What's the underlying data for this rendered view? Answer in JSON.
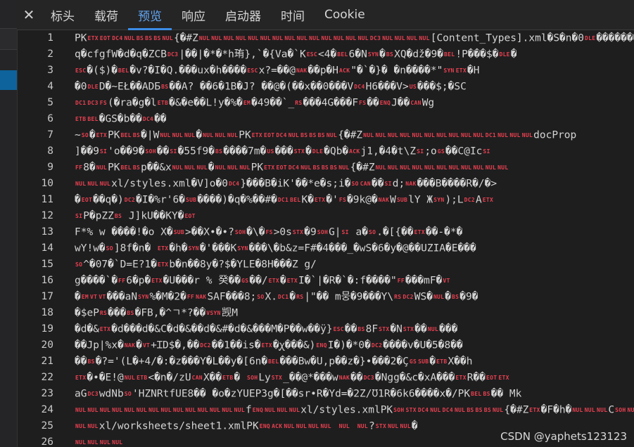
{
  "tabs": {
    "close_icon": "✕",
    "items": [
      "标头",
      "载荷",
      "预览",
      "响应",
      "启动器",
      "时间",
      "Cookie"
    ],
    "active_index": 2
  },
  "code": {
    "lines": [
      {
        "n": "1",
        "t": "PK[ETX][EOT][DC4][NUL][BS][BS][BS][NUL]{�#Z[NUL][NUL][NUL][NUL][NUL][NUL][NUL][NUL][NUL][NUL][NUL][NUL][NUL][NUL][DC3][NUL][NUL][NUL][NUL][Content_Types].xml�S�n�0[DLE]�������"
      },
      {
        "n": "2",
        "t": "q�cfgfW�d�q�ZCB[DC3]|��|�*�*h珛},`�{Va�`K[ESC]<4�[BEL]6�N[SYN]�[BS]XQ�dž�9�[BEL]!P���$�[DLE]�"
      },
      {
        "n": "3",
        "t": "[ESC]�($)�[BEL]�v?�I�Q.���ux�h����[ESC]x?=��@[NAK]��p�H[ACK]\"�`�}�   �n����*\"[SYN][ETX]�H"
      },
      {
        "n": "4",
        "t": "�0[DLE]D�~EŁ��ADБ[BS]��A? ��6�1B�J?  ��@�(��x��0���V[DC4]H6���V>[US]���$;�SC"
      },
      {
        "n": "5",
        "t": "[DC1][DC3][FS](�ra�g�l[ETB]�&�e��L!y�%�[EM]�49��`_[RS]���4G���F[FS]��[ENQ]J��[CAN]Wg"
      },
      {
        "n": "6",
        "t": "[ETB][BEL]�GS�b��[DC4]��"
      },
      {
        "n": "7",
        "t": "~[SO]�[ETX]PK[BEL][BS]�|W[NUL][NUL][NUL]�[NUL][NUL][NUL]PK[ETX][EOT][DC4][NUL][BS][BS][BS][NUL]{�#Z[NUL][NUL][NUL][NUL][NUL][NUL][NUL][NUL][NUL][NUL][DC1][NUL][NUL][NUL]docProp"
      },
      {
        "n": "8",
        "t": "]��9[SI]'o��9�[SOH]��[SI]�55f9�[BS]����7m�[US]���[STX]�[DLE]�Qb�[ACK]j1,�4�t\\Z[SI];o[GS]��C@Ic[SI]"
      },
      {
        "n": "9",
        "t": "[FF]8�[NUL]PK[BEL][BS]p��&x[NUL][NUL][NUL]�[NUL][NUL][NUL]PK[ETX][EOT][DC4][NUL][BS][BS][BS][NUL]{�#Z[NUL][NUL][NUL][NUL][NUL][NUL][NUL][NUL][NUL][NUL][NUL]"
      },
      {
        "n": "10",
        "t": "[NUL][NUL][NUL]xl/styles.xml�V]o�0[DC4]}���B�iK'��*e�s;i�[SO][CAN]��[SI]d;[NAK]���B����R�/�>"
      },
      {
        "n": "11",
        "t": "�[EOT]��q�)[DC2]�I�%r'6�[SUB]����)�q�%��#�[DC1][BEL]K�[ETX]�'[FS]�9k@�[NAK]W[SUB]lY Ж[SYN]);L[DC2]A[ETX]"
      },
      {
        "n": "12",
        "t": "[SI]P�pZZ[BS] J]kU��KY�[EOT]"
      },
      {
        "n": "13",
        "t": "F*% w   ����!�o X�[SUB]>��X•�•?[SOH]�\\�[FS]>0s[STX]�9[SOH]G|[SI]   a�[SO].�[{��[ETX]��-�*�"
      },
      {
        "n": "14",
        "t": "wY!w�[SO]]8f�n� [ETX]�h�[SYN]�'���K[SYN]���\\�b&z=F#�4���_�wS�6�y�@��UZIA�E���"
      },
      {
        "n": "15",
        "t": "[SO]^�07�`D=E?1�[ETX]b�n��8y�?$�YLE�8H���Z      g/"
      },
      {
        "n": "16",
        "t": "g����`�[FF]6�p�[ETX]�U���r  %  癸��[GS]��/[ETX]�[ETX]I�`|�R�`�:f����\"[FF]���mF�[VT]"
      },
      {
        "n": "17",
        "t": "�[EM][VT][VT]���aN[SYN]%�M�2�[FF][NAK]SAF���8;[SO]X.[DC1]�[RS]|\"�� m뭉�9���Y\\[RS][DC2]WS�[NUL]�[BS]�9�"
      },
      {
        "n": "18",
        "t": "�$eP[RS]���[BS]�FB,�^ㄱ*?��[VSYN]觊M"
      },
      {
        "n": "19",
        "t": "�d�&[ETX]�d���d�&C�d�&��d�&#�d�&���M�P��w��ÿ}[ESC]��[BS]8F[STX]�N[STX]��[NUL]���"
      },
      {
        "n": "20",
        "t": "��Jp|%x�[NAK]�[VT]+ꞮD$�,��[DC2]��1��is�[ETX]�ꭕ���&)[ENQ]I�)�*0�[DC2]����v�U�5�8��"
      },
      {
        "n": "21",
        "t": "��[BS]�?='(L�+4/�:�z���Y�L��y�[6n�[BEL]���Bw�U,p��z�}•���2�Ç[GS][SUB]�[ETB]X��h"
      },
      {
        "n": "22",
        "t": "[ETX]�•�E!@[NUL][ETB]<�n�/zU[CAN]X��[ETB]�  [SOH]Ly[STX]_��@*���w[NAK]��[DC3]�Ngg�&c�xA���[ETX]R��[EOT][ETX]"
      },
      {
        "n": "23",
        "t": "aG[DC3]wdNb[SO]'HZNRtfUE8�� �o�zYUEP3g�[��sr•R�Yd=�2Z/Ʊ1R�6k6����x�/PK[BEL][BS]��  Mk"
      },
      {
        "n": "24",
        "t": "[NUL][NUL][NUL][NUL][NUL][NUL][NUL][NUL][NUL][NUL][NUL][NUL][NUL][NUL]f[ENQ][NUL][NUL][NUL]xl/styles.xmlPK[SOH][STX][DC4][NUL][DC4][NUL][BS][BS][BS][NUL]{�#Z[ETX]�F�h�[NUL][NUL][NUL]C[SOH][NUL][NUL]"
      },
      {
        "n": "25",
        "t": "[NUL][NUL]xl/worksheets/sheet1.xmlPK[ENQ][ACK][NUL][NUL][NUL][NUL]    [NUL]   [NUL]?[STX][NUL][NUL]�"
      },
      {
        "n": "26",
        "t": "[NUL][NUL][NUL][NUL]"
      }
    ]
  },
  "watermark": "CSDN @yaphets123123",
  "colors": {
    "accent": "#3c8ce7",
    "control_char": "#e8404f",
    "background": "#1e1e1f"
  }
}
